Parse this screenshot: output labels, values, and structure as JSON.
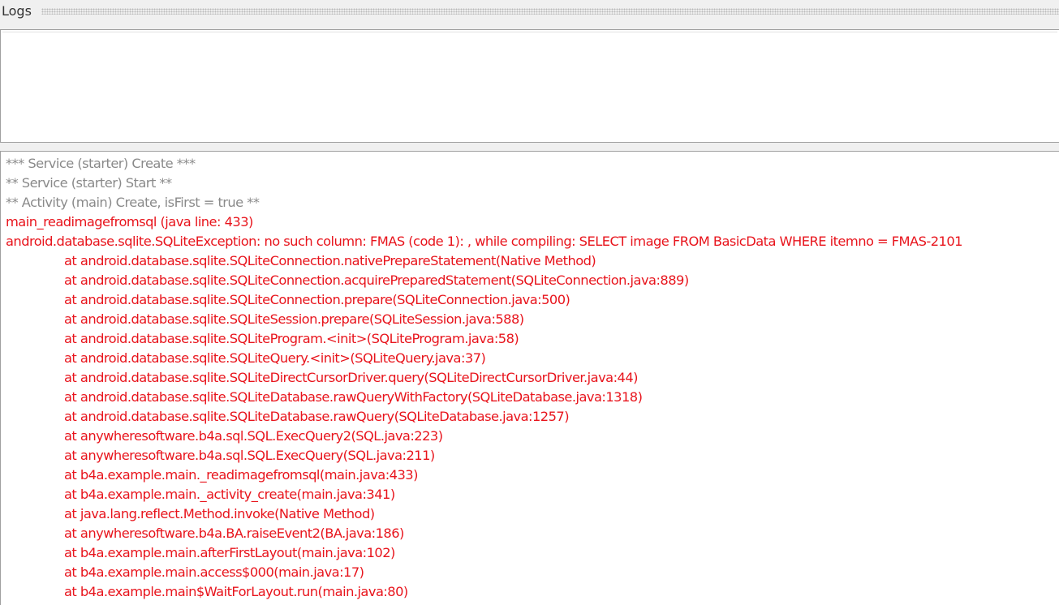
{
  "header": {
    "title": "Logs"
  },
  "colors": {
    "info": "#8a8a8a",
    "error": "#e8141c",
    "background": "#ffffff",
    "chrome": "#f0f0f0"
  },
  "log": {
    "lines": [
      {
        "type": "info",
        "text": "*** Service (starter) Create ***"
      },
      {
        "type": "info",
        "text": "** Service (starter) Start **"
      },
      {
        "type": "info",
        "text": "** Activity (main) Create, isFirst = true **"
      },
      {
        "type": "error",
        "text": "main_readimagefromsql (java line: 433)"
      },
      {
        "type": "error",
        "text": "android.database.sqlite.SQLiteException: no such column: FMAS (code 1): , while compiling: SELECT image FROM BasicData WHERE itemno = FMAS-2101"
      },
      {
        "type": "trace",
        "text": "at android.database.sqlite.SQLiteConnection.nativePrepareStatement(Native Method)"
      },
      {
        "type": "trace",
        "text": "at android.database.sqlite.SQLiteConnection.acquirePreparedStatement(SQLiteConnection.java:889)"
      },
      {
        "type": "trace",
        "text": "at android.database.sqlite.SQLiteConnection.prepare(SQLiteConnection.java:500)"
      },
      {
        "type": "trace",
        "text": "at android.database.sqlite.SQLiteSession.prepare(SQLiteSession.java:588)"
      },
      {
        "type": "trace",
        "text": "at android.database.sqlite.SQLiteProgram.<init>(SQLiteProgram.java:58)"
      },
      {
        "type": "trace",
        "text": "at android.database.sqlite.SQLiteQuery.<init>(SQLiteQuery.java:37)"
      },
      {
        "type": "trace",
        "text": "at android.database.sqlite.SQLiteDirectCursorDriver.query(SQLiteDirectCursorDriver.java:44)"
      },
      {
        "type": "trace",
        "text": "at android.database.sqlite.SQLiteDatabase.rawQueryWithFactory(SQLiteDatabase.java:1318)"
      },
      {
        "type": "trace",
        "text": "at android.database.sqlite.SQLiteDatabase.rawQuery(SQLiteDatabase.java:1257)"
      },
      {
        "type": "trace",
        "text": "at anywheresoftware.b4a.sql.SQL.ExecQuery2(SQL.java:223)"
      },
      {
        "type": "trace",
        "text": "at anywheresoftware.b4a.sql.SQL.ExecQuery(SQL.java:211)"
      },
      {
        "type": "trace",
        "text": "at b4a.example.main._readimagefromsql(main.java:433)"
      },
      {
        "type": "trace",
        "text": "at b4a.example.main._activity_create(main.java:341)"
      },
      {
        "type": "trace",
        "text": "at java.lang.reflect.Method.invoke(Native Method)"
      },
      {
        "type": "trace",
        "text": "at anywheresoftware.b4a.BA.raiseEvent2(BA.java:186)"
      },
      {
        "type": "trace",
        "text": "at b4a.example.main.afterFirstLayout(main.java:102)"
      },
      {
        "type": "trace",
        "text": "at b4a.example.main.access$000(main.java:17)"
      },
      {
        "type": "trace",
        "text": "at b4a.example.main$WaitForLayout.run(main.java:80)"
      }
    ]
  }
}
